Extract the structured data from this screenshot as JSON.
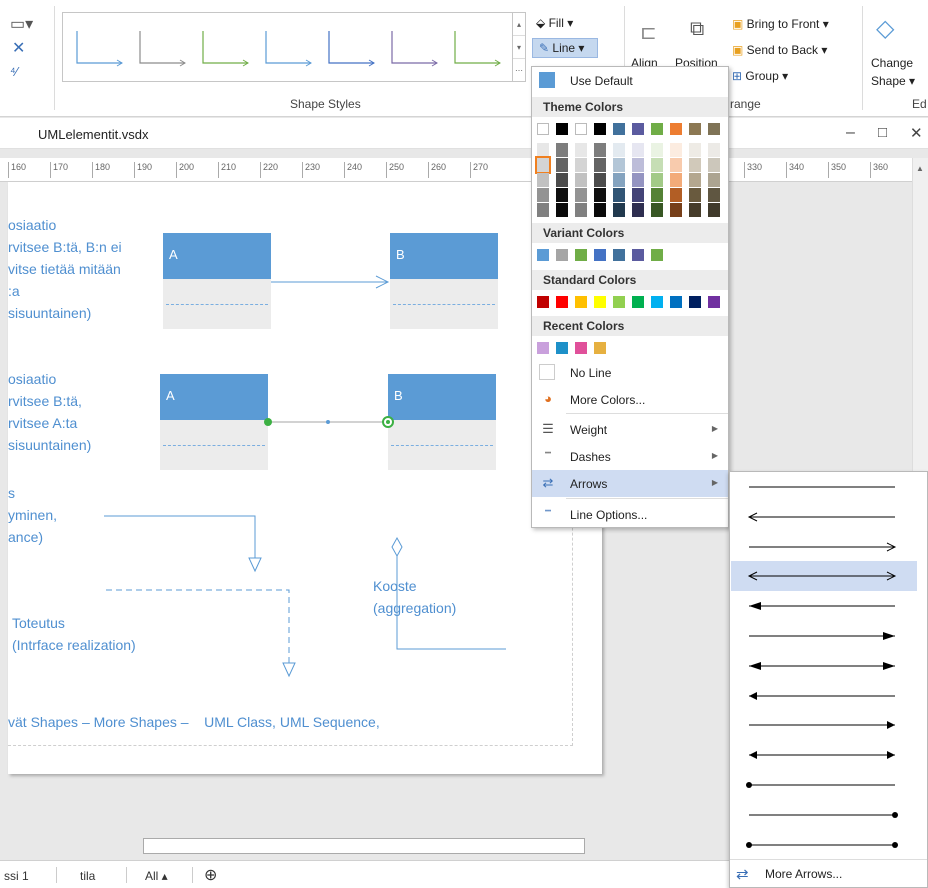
{
  "ribbon": {
    "groups": {
      "shape_styles": "Shape Styles",
      "arrange": "range",
      "editing": "Ed"
    },
    "fill_label": "Fill",
    "line_label": "Line",
    "align_label": "Align",
    "position_label": "Position",
    "bring_front": "Bring to Front",
    "send_back": "Send to Back",
    "group_label": "Group",
    "change_shape_1": "Change",
    "change_shape_2": "Shape",
    "style_thumb_colors": [
      "#5b9bd5",
      "#8c8c8c",
      "#70ad47",
      "#5b9bd5",
      "#4472c4",
      "#7b6aa7",
      "#70ad47"
    ]
  },
  "document": {
    "title": "UMLelementit.vsdx",
    "minimize": "–",
    "maximize": "□",
    "close": "✕"
  },
  "ruler": {
    "ticks": [
      "160",
      "170",
      "180",
      "190",
      "200",
      "210",
      "220",
      "230",
      "240",
      "250",
      "260",
      "270",
      "330",
      "340",
      "350",
      "360"
    ]
  },
  "canvas": {
    "assoc1_text": "osiaatio\nrvitsee B:tä, B:n ei\nvitse tietää mitään\n:a\nsisuuntainen)",
    "assoc2_text": "osiaatio\nrvitsee B:tä,\nrvitsee A:ta\nsisuuntainen)",
    "inherit_text": "s\nyminen,\nance)",
    "realization_text": "Toteutus\n(Intrface realization)",
    "aggregation_text": "Kooste\n(aggregation)",
    "footer_text": "vät Shapes – More Shapes –    UML Class, UML Sequence,",
    "class_a": "A",
    "class_b": "B"
  },
  "line_menu": {
    "use_default": "Use Default",
    "theme_colors": "Theme Colors",
    "variant_colors": "Variant Colors",
    "standard_colors": "Standard Colors",
    "recent_colors": "Recent Colors",
    "no_line": "No Line",
    "more_colors": "More Colors...",
    "weight": "Weight",
    "dashes": "Dashes",
    "arrows": "Arrows",
    "line_options": "Line Options...",
    "theme_top_row": [
      "#ffffff",
      "#000000",
      "#ffffff",
      "#000000",
      "#41719c",
      "#5b5b9f",
      "#70ad47",
      "#ed7d31",
      "#8c7853",
      "#7f7356"
    ],
    "variant_row": [
      "#5b9bd5",
      "#a5a5a5",
      "#70ad47",
      "#4472c4",
      "#41719c",
      "#5b5b9f",
      "#70ad47"
    ],
    "standard_row": [
      "#c00000",
      "#ff0000",
      "#ffc000",
      "#ffff00",
      "#92d050",
      "#00b050",
      "#00b0f0",
      "#0070c0",
      "#002060",
      "#7030a0"
    ],
    "recent_row": [
      "#c9a0dc",
      "#1e90c8",
      "#e0509a",
      "#e6b040"
    ]
  },
  "arrows_menu": {
    "more_arrows": "More Arrows...",
    "options_count": 13
  },
  "status": {
    "sheet1": "ssi 1",
    "sheet2": "tila",
    "all": "All ▴",
    "add": "⊕"
  }
}
